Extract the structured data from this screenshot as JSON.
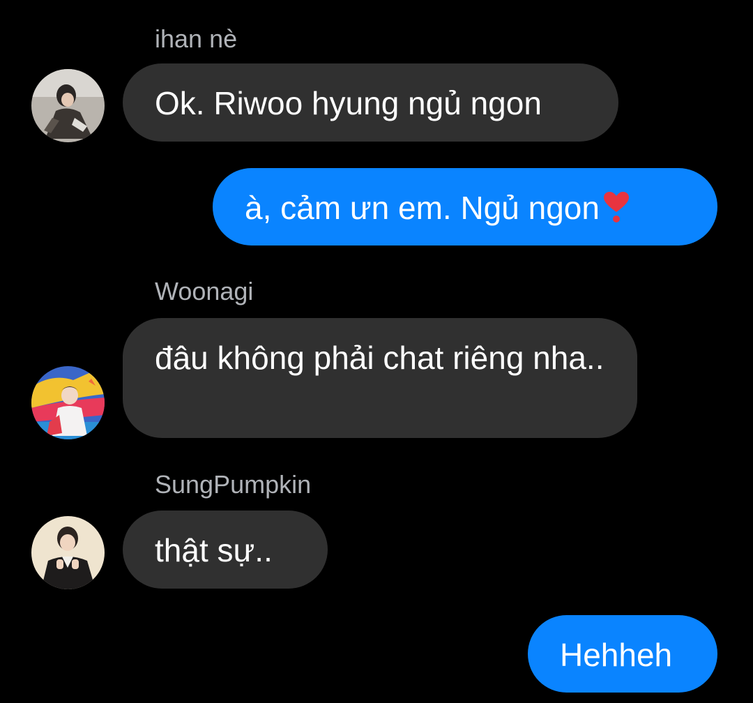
{
  "messages": [
    {
      "type": "incoming",
      "sender": "ihan nè",
      "text": "Ok. Riwoo hyung ngủ ngon",
      "avatar_icon": "user-avatar-1"
    },
    {
      "type": "outgoing",
      "text": "à, cảm ưn em. Ngủ ngon",
      "emoji_icon": "heart-exclamation-icon"
    },
    {
      "type": "incoming",
      "sender": "Woonagi",
      "text": "đâu không phải chat riêng nha..",
      "avatar_icon": "user-avatar-2"
    },
    {
      "type": "incoming",
      "sender": "SungPumpkin",
      "text": "thật sự..",
      "avatar_icon": "user-avatar-3"
    },
    {
      "type": "outgoing",
      "text": "Hehheh"
    }
  ],
  "colors": {
    "background": "#000000",
    "incoming_bubble": "#303030",
    "outgoing_bubble": "#0a84ff",
    "sender_name": "#b0b3b8",
    "text": "#ffffff"
  }
}
